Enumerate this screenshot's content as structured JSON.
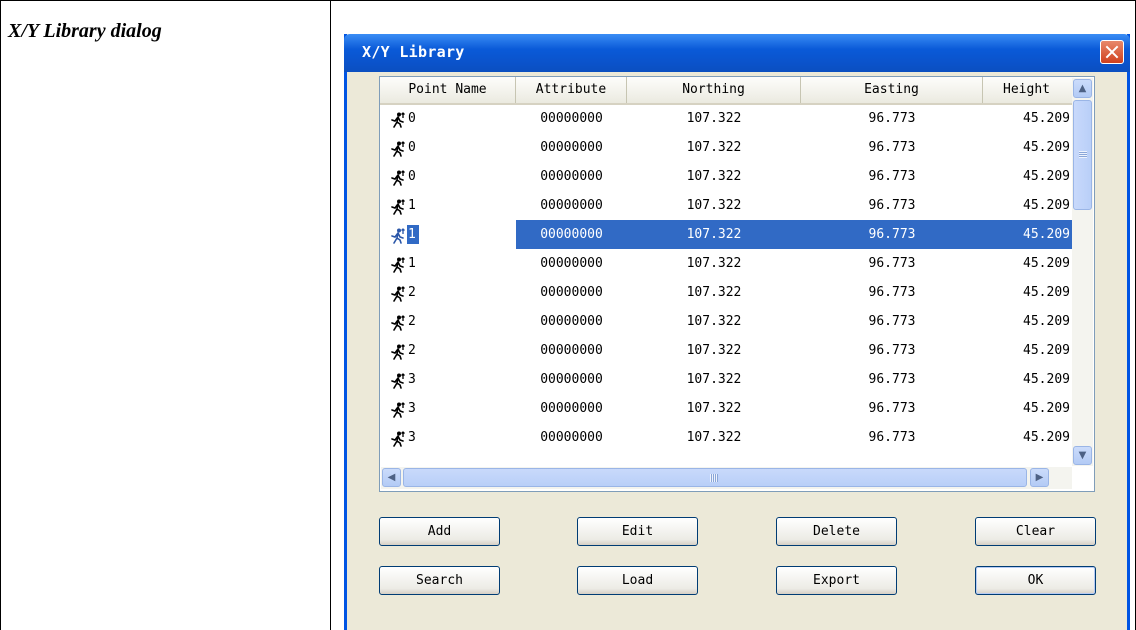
{
  "document": {
    "caption": "X/Y Library dialog"
  },
  "dialog": {
    "title": "X/Y Library",
    "close_icon": "close-icon"
  },
  "table": {
    "columns": [
      "Point Name",
      "Attribute",
      "Northing",
      "Easting",
      "Height"
    ],
    "selected_row_index": 4,
    "rows": [
      {
        "name": "0",
        "attribute": "00000000",
        "northing": "107.322",
        "easting": "96.773",
        "height": "45.209"
      },
      {
        "name": "0",
        "attribute": "00000000",
        "northing": "107.322",
        "easting": "96.773",
        "height": "45.209"
      },
      {
        "name": "0",
        "attribute": "00000000",
        "northing": "107.322",
        "easting": "96.773",
        "height": "45.209"
      },
      {
        "name": "1",
        "attribute": "00000000",
        "northing": "107.322",
        "easting": "96.773",
        "height": "45.209"
      },
      {
        "name": "1",
        "attribute": "00000000",
        "northing": "107.322",
        "easting": "96.773",
        "height": "45.209"
      },
      {
        "name": "1",
        "attribute": "00000000",
        "northing": "107.322",
        "easting": "96.773",
        "height": "45.209"
      },
      {
        "name": "2",
        "attribute": "00000000",
        "northing": "107.322",
        "easting": "96.773",
        "height": "45.209"
      },
      {
        "name": "2",
        "attribute": "00000000",
        "northing": "107.322",
        "easting": "96.773",
        "height": "45.209"
      },
      {
        "name": "2",
        "attribute": "00000000",
        "northing": "107.322",
        "easting": "96.773",
        "height": "45.209"
      },
      {
        "name": "3",
        "attribute": "00000000",
        "northing": "107.322",
        "easting": "96.773",
        "height": "45.209"
      },
      {
        "name": "3",
        "attribute": "00000000",
        "northing": "107.322",
        "easting": "96.773",
        "height": "45.209"
      },
      {
        "name": "3",
        "attribute": "00000000",
        "northing": "107.322",
        "easting": "96.773",
        "height": "45.209"
      }
    ],
    "row_icon": "running-person-icon"
  },
  "buttons": {
    "add": "Add",
    "edit": "Edit",
    "delete": "Delete",
    "clear": "Clear",
    "search": "Search",
    "load": "Load",
    "export": "Export",
    "ok": "OK"
  },
  "colors": {
    "selection": "#316ac5",
    "titlebar": "#0b52c9",
    "dialog_bg": "#ece9d8"
  }
}
